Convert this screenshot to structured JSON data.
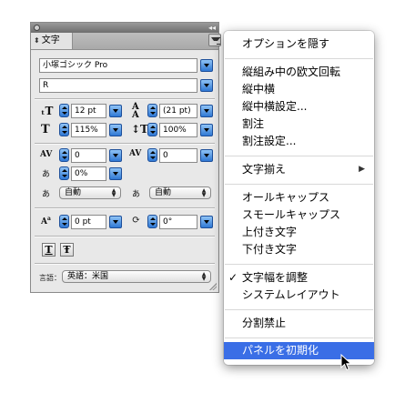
{
  "panel": {
    "tab_label": "文字",
    "font_family": "小塚ゴシック Pro",
    "font_style": "R",
    "font_size": "12 pt",
    "leading": "(21 pt)",
    "vertical_scale": "115%",
    "horizontal_scale": "100%",
    "kerning": "0",
    "tracking": "0",
    "tsume": "0%",
    "aki_left": "自動",
    "aki_right": "自動",
    "baseline_shift": "0 pt",
    "rotation": "0°",
    "language_label": "言語：",
    "language": "英語：米国",
    "tate_chu_yoko_btn": "T",
    "warichu_btn": "Ŧ"
  },
  "menu": {
    "items": [
      {
        "label": "オプションを隠す"
      },
      {
        "label": "縦組み中の欧文回転"
      },
      {
        "label": "縦中横"
      },
      {
        "label": "縦中横設定..."
      },
      {
        "label": "割注"
      },
      {
        "label": "割注設定..."
      },
      {
        "label": "文字揃え",
        "submenu_arrow": "▶"
      },
      {
        "label": "オールキャップス"
      },
      {
        "label": "スモールキャップス"
      },
      {
        "label": "上付き文字"
      },
      {
        "label": "下付き文字"
      },
      {
        "label": "文字幅を調整",
        "check": "✓"
      },
      {
        "label": "システムレイアウト"
      },
      {
        "label": "分割禁止"
      },
      {
        "label": "パネルを初期化"
      }
    ],
    "highlighted": "パネルを初期化",
    "highlight_color": "#3a6ee6"
  }
}
